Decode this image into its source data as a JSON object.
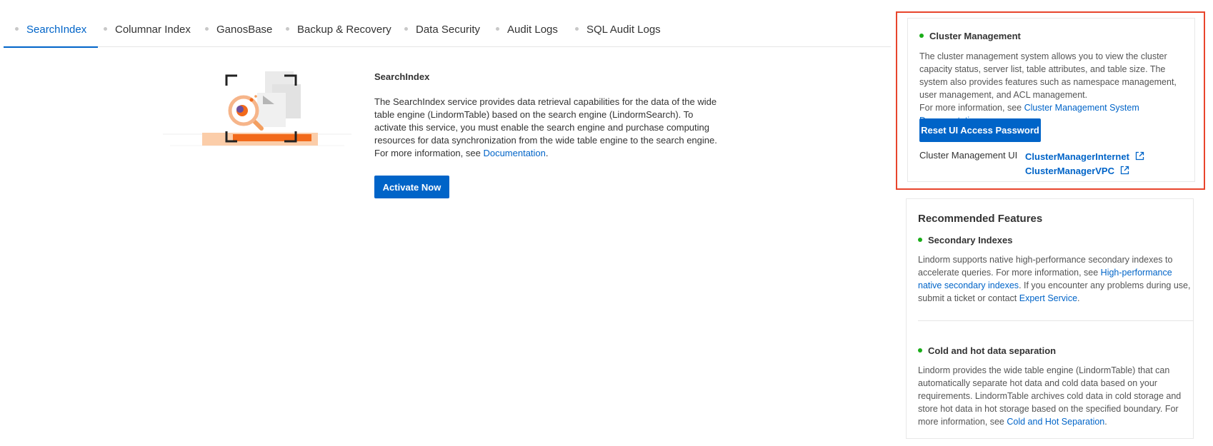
{
  "tabs": [
    {
      "label": "SearchIndex",
      "active": true
    },
    {
      "label": "Columnar Index",
      "active": false
    },
    {
      "label": "GanosBase",
      "active": false
    },
    {
      "label": "Backup & Recovery",
      "active": false
    },
    {
      "label": "Data Security",
      "active": false
    },
    {
      "label": "Audit Logs",
      "active": false
    },
    {
      "label": "SQL Audit Logs",
      "active": false
    }
  ],
  "main": {
    "title": "SearchIndex",
    "description": "The SearchIndex service provides data retrieval capabilities for the data of the wide table engine (LindormTable) based on the search engine (LindormSearch). To activate this service, you must enable the search engine and purchase computing resources for data synchronization from the wide table engine to the search engine. For more information, see ",
    "doc_link": "Documentation",
    "doc_suffix": ".",
    "activate_label": "Activate Now"
  },
  "cluster": {
    "heading": "Cluster Management",
    "description": "The cluster management system allows you to view the cluster capacity status, server list, table attributes, and table size. The system also provides features such as namespace management, user management, and ACL management.",
    "more_prefix": "For more information, see ",
    "more_link": "Cluster Management System Documentation",
    "more_suffix": ".",
    "reset_label": "Reset UI Access Password",
    "ui_label": "Cluster Management UI",
    "links": [
      "ClusterManagerInternet",
      "ClusterManagerVPC"
    ]
  },
  "recommended": {
    "title": "Recommended Features",
    "features": [
      {
        "heading": "Secondary Indexes",
        "desc_1": "Lindorm supports native high-performance secondary indexes to accelerate queries. For more information, see ",
        "link_1": "High-performance native secondary indexes",
        "desc_2": ". If you encounter any problems during use, submit a ticket or contact ",
        "link_2": "Expert Service",
        "desc_3": "."
      },
      {
        "heading": "Cold and hot data separation",
        "desc_1": "Lindorm provides the wide table engine (LindormTable) that can automatically separate hot data and cold data based on your requirements. LindormTable archives cold data in cold storage and store hot data in hot storage based on the specified boundary. For more information, see ",
        "link_1": "Cold and Hot Separation",
        "desc_2": "."
      }
    ]
  },
  "colors": {
    "accent": "#0064c8",
    "highlight_border": "#e8452c",
    "status_dot": "#1aad19",
    "illustration_orange": "#f26a1b"
  },
  "icons": {
    "external_link": "external-link-icon",
    "illustration": "search-document-illustration"
  }
}
